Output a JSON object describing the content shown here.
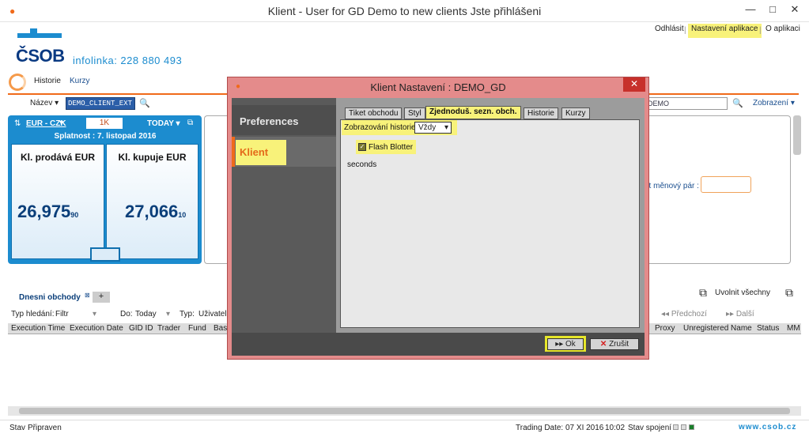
{
  "window": {
    "title": "Klient - User for GD Demo to new clients Jste přihlášeni",
    "minimize_icon": "minimize-icon",
    "maximize_icon": "maximize-icon",
    "close_icon": "close-icon"
  },
  "header": {
    "links": [
      "Odhlásit",
      "Nastavení aplikace",
      "O aplikaci"
    ],
    "logo_text": "ČSOB",
    "infoline": "infolinka: 228 880 493"
  },
  "nav": {
    "tabs": [
      "Historie",
      "Kurzy"
    ]
  },
  "toolbar": {
    "name_label": "Název",
    "name_value": "DEMO_CLIENT_EXT",
    "right_value": "DEMO",
    "view_label": "Zobrazení"
  },
  "rate_panel": {
    "pair": "EUR - CZK",
    "amount": "1K",
    "tenor": "TODAY",
    "settlement": "Splatnost : 7. listopad 2016",
    "sell_label": "Kl. prodává EUR",
    "buy_label": "Kl. kupuje EUR",
    "sell_main": "26,975",
    "sell_pips": "90",
    "buy_main": "27,066",
    "buy_pips": "10"
  },
  "right_panel": {
    "pair_label": "at měnový pár :"
  },
  "trades": {
    "title": "Dnesni obchody",
    "add_label": "+",
    "release_all": "Uvolnit všechny",
    "filters": {
      "search_type_label": "Typ hledání:",
      "search_type_value": "Filtr",
      "to_label": "Do:",
      "to_value": "Today",
      "type_label": "Typ:",
      "type_value": "Uživatel"
    },
    "prev": "Předchozí",
    "next": "Další",
    "columns_left": [
      "Execution Time",
      "Execution Date",
      "GID ID",
      "Trader",
      "Fund",
      "Bas"
    ],
    "columns_right": [
      "Proxy",
      "Unregistered Name",
      "Status",
      "MM"
    ]
  },
  "statusbar": {
    "label": "Stav",
    "value": "Připraven",
    "trading_date": "Trading Date: 07 XI 2016",
    "time": "10:02",
    "connection": "Stav spojení",
    "www": "www.csob.cz",
    "led_colors": [
      "#dddddd",
      "#dddddd",
      "#1a7f2a"
    ]
  },
  "modal": {
    "title": "Klient Nastavení : DEMO_GD",
    "sidebar_title": "Preferences",
    "sidebar_item": "Klient",
    "tabs": [
      "Tiket obchodu",
      "Styl",
      "Zjednoduš. sezn. obch.",
      "Historie",
      "Kurzy"
    ],
    "active_tab": "Zjednoduš. sezn. obch.",
    "history_label": "Zobrazování historie",
    "history_value": "Vždy",
    "flash_blotter": "Flash Blotter",
    "flash_checked": true,
    "seconds": "seconds",
    "ok_label": "Ok",
    "cancel_label": "Zrušit"
  },
  "colors": {
    "accent_orange": "#f06a1a",
    "brand_blue": "#1c8ccf",
    "highlight_yellow": "#f8f27a",
    "modal_border": "#e48b8b"
  }
}
